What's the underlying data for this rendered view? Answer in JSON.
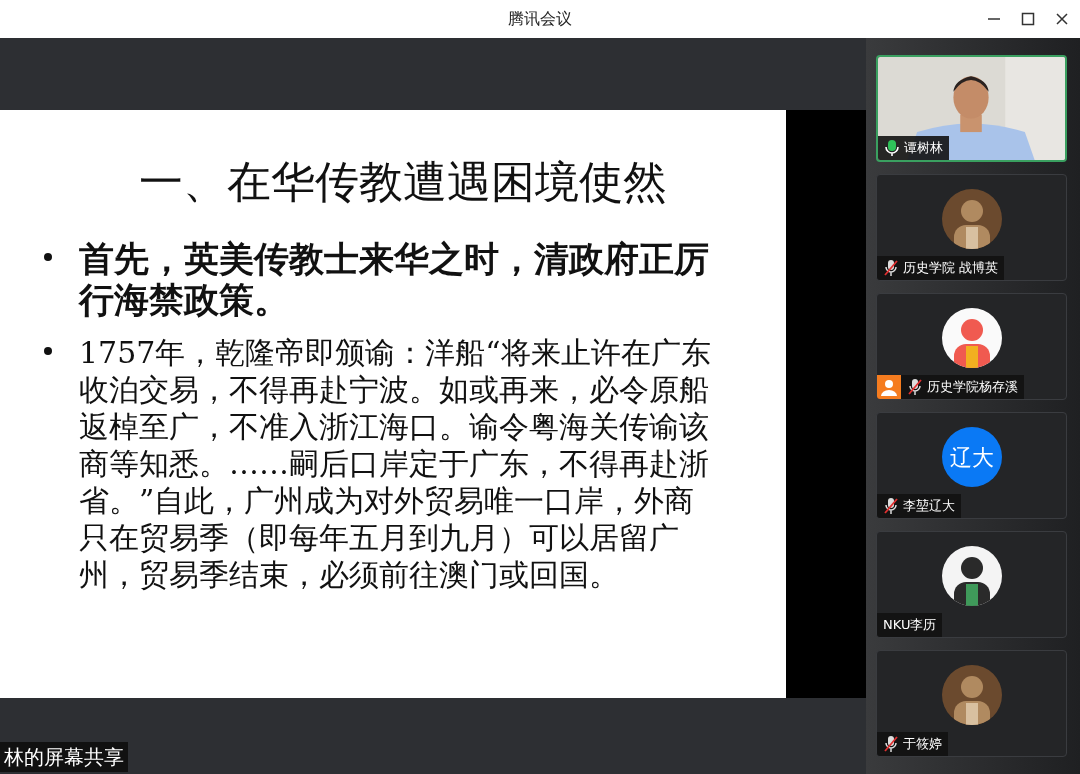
{
  "window": {
    "title": "腾讯会议"
  },
  "slide": {
    "title": "一、在华传教遭遇困境使然",
    "bullets": [
      {
        "kind": "major",
        "text": "首先，英美传教士来华之时，清政府正厉行海禁政策。"
      },
      {
        "kind": "minor",
        "text": "1757年，乾隆帝即颁谕：洋船“将来止许在广东收泊交易，不得再赴宁波。如或再来，必令原船返棹至广，不准入浙江海口。谕令粤海关传谕该商等知悉。……嗣后口岸定于广东，不得再赴浙省。”自此，广州成为对外贸易唯一口岸，外商只在贸易季（即每年五月到九月）可以居留广州，贸易季结束，必须前往澳门或回国。"
      }
    ]
  },
  "share_label": "林的屏幕共享",
  "participants": [
    {
      "name": "谭树林",
      "kind": "video",
      "mic_visible": true,
      "muted": false,
      "speaking": true
    },
    {
      "name": "历史学院 战博英",
      "mic_visible": true,
      "muted": true,
      "speaking": false
    },
    {
      "name": "历史学院杨存溪",
      "mic_visible": true,
      "muted": true,
      "speaking": false,
      "host_badge": true
    },
    {
      "name": "李堃辽大",
      "kind": "text",
      "avatar_text": "辽大",
      "color": "#0a79f5",
      "mic_visible": true,
      "muted": true,
      "speaking": false
    },
    {
      "name": "NKU李历",
      "mic_visible": false,
      "speaking": false
    },
    {
      "name": "于筱婷",
      "mic_visible": true,
      "muted": true,
      "speaking": false
    }
  ]
}
